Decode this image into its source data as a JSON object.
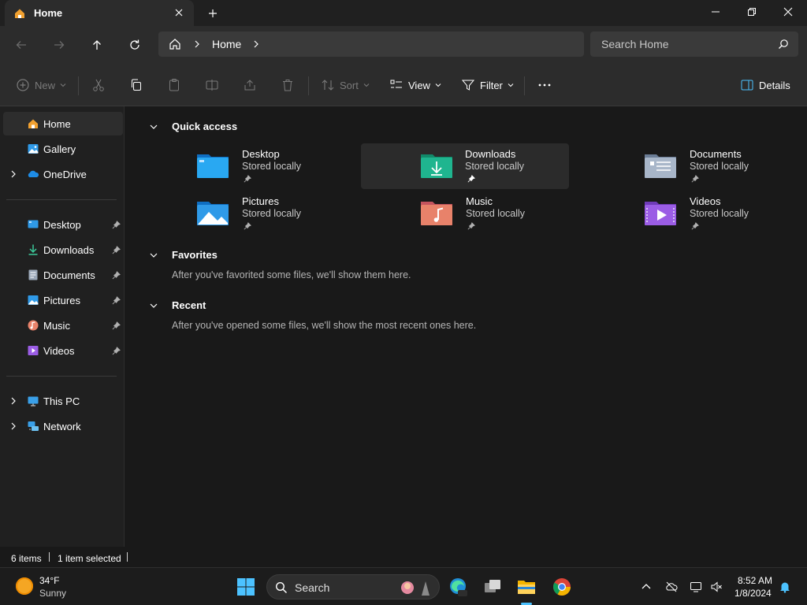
{
  "tab": {
    "title": "Home"
  },
  "address": {
    "crumb": "Home"
  },
  "search": {
    "placeholder": "Search Home"
  },
  "commands": {
    "new": "New",
    "sort": "Sort",
    "view": "View",
    "filter": "Filter",
    "details": "Details"
  },
  "sidebar": {
    "top": [
      {
        "label": "Home",
        "icon": "home-icon",
        "selected": true
      },
      {
        "label": "Gallery",
        "icon": "gallery-icon"
      },
      {
        "label": "OneDrive",
        "icon": "onedrive-icon",
        "expandable": true
      }
    ],
    "pinned": [
      {
        "label": "Desktop",
        "icon": "desktop-folder-icon"
      },
      {
        "label": "Downloads",
        "icon": "downloads-folder-icon"
      },
      {
        "label": "Documents",
        "icon": "documents-folder-icon"
      },
      {
        "label": "Pictures",
        "icon": "pictures-folder-icon"
      },
      {
        "label": "Music",
        "icon": "music-folder-icon"
      },
      {
        "label": "Videos",
        "icon": "videos-folder-icon"
      }
    ],
    "bottom": [
      {
        "label": "This PC",
        "icon": "this-pc-icon"
      },
      {
        "label": "Network",
        "icon": "network-icon"
      }
    ]
  },
  "sections": {
    "quick_access": "Quick access",
    "favorites": "Favorites",
    "favorites_empty": "After you've favorited some files, we'll show them here.",
    "recent": "Recent",
    "recent_empty": "After you've opened some files, we'll show the most recent ones here."
  },
  "quick_access": [
    {
      "name": "Desktop",
      "sub": "Stored locally",
      "color": "#1f9cf0"
    },
    {
      "name": "Downloads",
      "sub": "Stored locally",
      "color": "#1fb58f",
      "highlighted": true
    },
    {
      "name": "Documents",
      "sub": "Stored locally",
      "color": "#8fa3bf"
    },
    {
      "name": "Pictures",
      "sub": "Stored locally",
      "color": "#2f9ae8"
    },
    {
      "name": "Music",
      "sub": "Stored locally",
      "color": "#e8826a"
    },
    {
      "name": "Videos",
      "sub": "Stored locally",
      "color": "#9b5de5"
    }
  ],
  "status": {
    "items": "6 items",
    "selected": "1 item selected"
  },
  "taskbar": {
    "weather_temp": "34°F",
    "weather_desc": "Sunny",
    "search_label": "Search",
    "time": "8:52 AM",
    "date": "1/8/2024"
  },
  "colors": {
    "accent": "#4cc2ff",
    "background": "#191919"
  }
}
